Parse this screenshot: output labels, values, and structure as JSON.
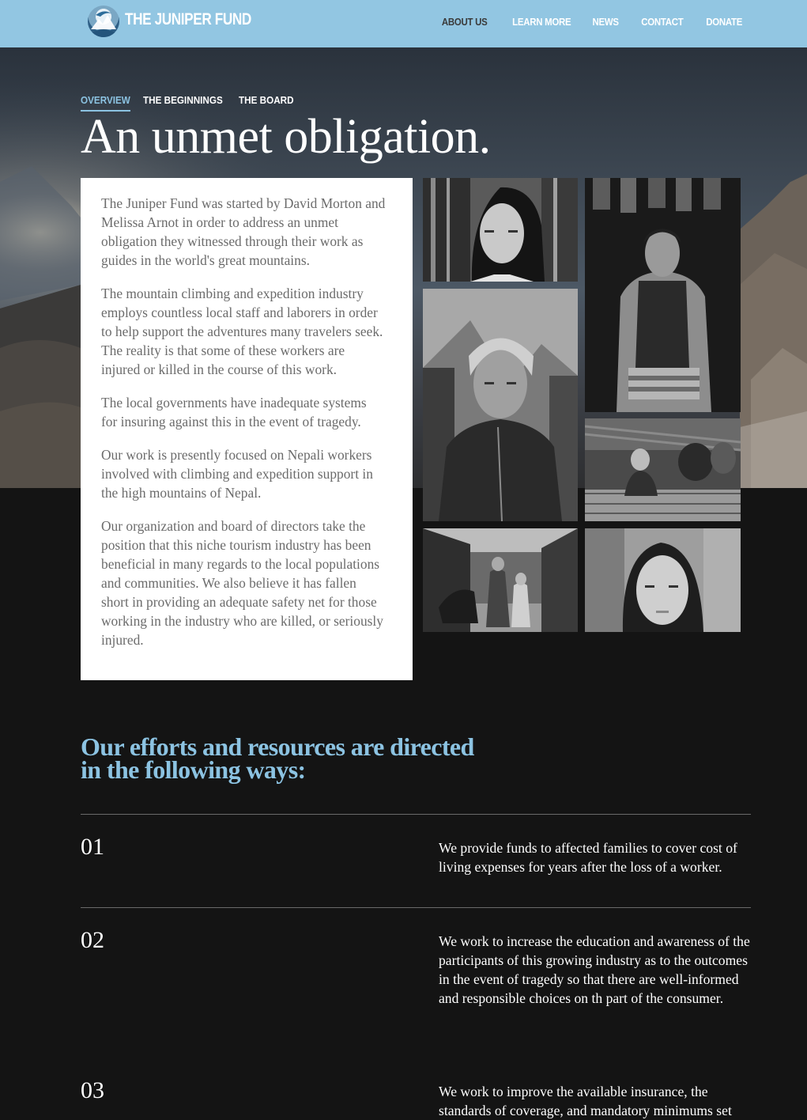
{
  "header": {
    "brand": "THE JUNIPER FUND",
    "nav": [
      "ABOUT US",
      "LEARN MORE",
      "NEWS",
      "CONTACT",
      "DONATE"
    ],
    "active_nav": "ABOUT US"
  },
  "subnav": {
    "items": [
      "OVERVIEW",
      "THE BEGINNINGS",
      "THE BOARD"
    ],
    "active": "OVERVIEW"
  },
  "hero": {
    "headline": "An unmet obligation."
  },
  "intro": {
    "paragraphs": [
      "The Juniper Fund was started by David Morton and Melissa Arnot in order to address an unmet obligation they witnessed through their work as guides in the world's great mountains.",
      "The mountain climbing and expedition industry employs countless local staff and laborers in order to help support the adventures many travelers seek. The reality is that some of these workers are injured or killed in the course of this work.",
      "The local governments have inadequate systems for insuring against this in the event of tragedy.",
      "Our work is presently focused on Nepali workers involved with climbing and expedition support in the high mountains of Nepal.",
      "Our organization and board of directors take the position that this niche tourism industry has been beneficial in many regards to the local populations and communities. We also believe it has fallen short in providing an adequate safety net for those working in the industry who are killed, or seriously injured."
    ]
  },
  "photos": [
    "young-woman-portrait",
    "seated-man-portrait",
    "woman-in-headscarf-portrait",
    "child-in-kitchen",
    "villagers-with-yak",
    "woman-close-portrait"
  ],
  "efforts": {
    "title": "Our efforts and resources are directed in the following ways:",
    "items": [
      {
        "number": "01",
        "text": "We provide funds to affected families to cover cost of living expenses for years after the loss of a worker."
      },
      {
        "number": "02",
        "text": "We work to increase the education and awareness of the participants of this growing industry as to the outcomes in the event of tragedy so that there are well-informed and responsible choices on th part of the consumer."
      },
      {
        "number": "03",
        "text": "We work to improve the available insurance, the standards of coverage, and mandatory minimums set"
      }
    ]
  },
  "colors": {
    "header_bg": "#92c6e2",
    "accent": "#8cc3e2",
    "dark_bg": "#141414",
    "body_text": "#6b6b6b"
  }
}
